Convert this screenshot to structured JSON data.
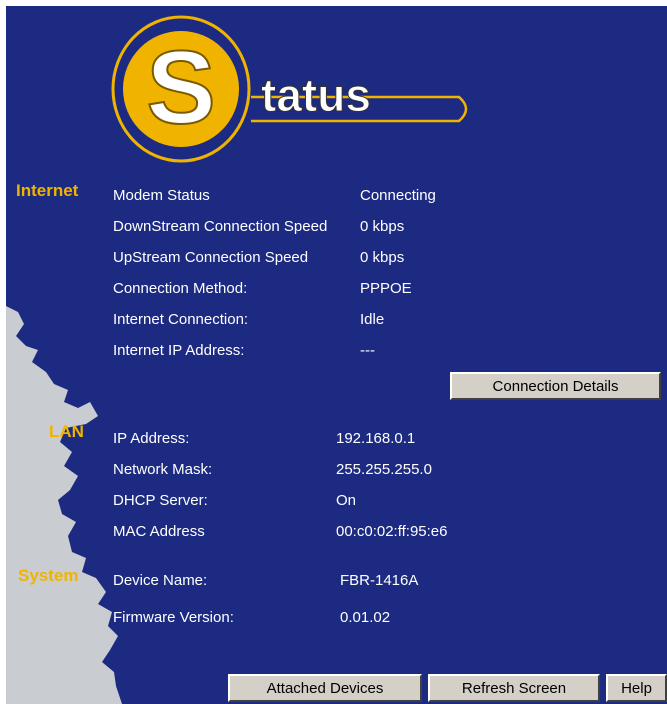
{
  "logo": {
    "letter": "S",
    "word": "tatus"
  },
  "sections": {
    "internet": "Internet",
    "lan": "LAN",
    "system": "System"
  },
  "internet": {
    "modem_status": {
      "label": "Modem Status",
      "value": "Connecting"
    },
    "downstream": {
      "label": "DownStream Connection Speed",
      "value": "0 kbps"
    },
    "upstream": {
      "label": "UpStream Connection Speed",
      "value": "0 kbps"
    },
    "method": {
      "label": "Connection Method:",
      "value": "PPPOE"
    },
    "connection": {
      "label": "Internet Connection:",
      "value": "Idle"
    },
    "ip": {
      "label": "Internet IP Address:",
      "value": "---"
    }
  },
  "lan": {
    "ip": {
      "label": "IP Address:",
      "value": "192.168.0.1"
    },
    "mask": {
      "label": "Network Mask:",
      "value": "255.255.255.0"
    },
    "dhcp": {
      "label": "DHCP Server:",
      "value": "On"
    },
    "mac": {
      "label": "MAC Address",
      "value": "00:c0:02:ff:95:e6"
    }
  },
  "system": {
    "device": {
      "label": "Device Name:",
      "value": "FBR-1416A"
    },
    "firmware": {
      "label": "Firmware Version:",
      "value": "0.01.02"
    }
  },
  "buttons": {
    "connection_details": "Connection Details",
    "attached_devices": "Attached Devices",
    "refresh_screen": "Refresh Screen",
    "help": "Help"
  },
  "colors": {
    "background": "#1c2a82",
    "accent": "#f0b400",
    "coast": "#c9cdd2"
  }
}
